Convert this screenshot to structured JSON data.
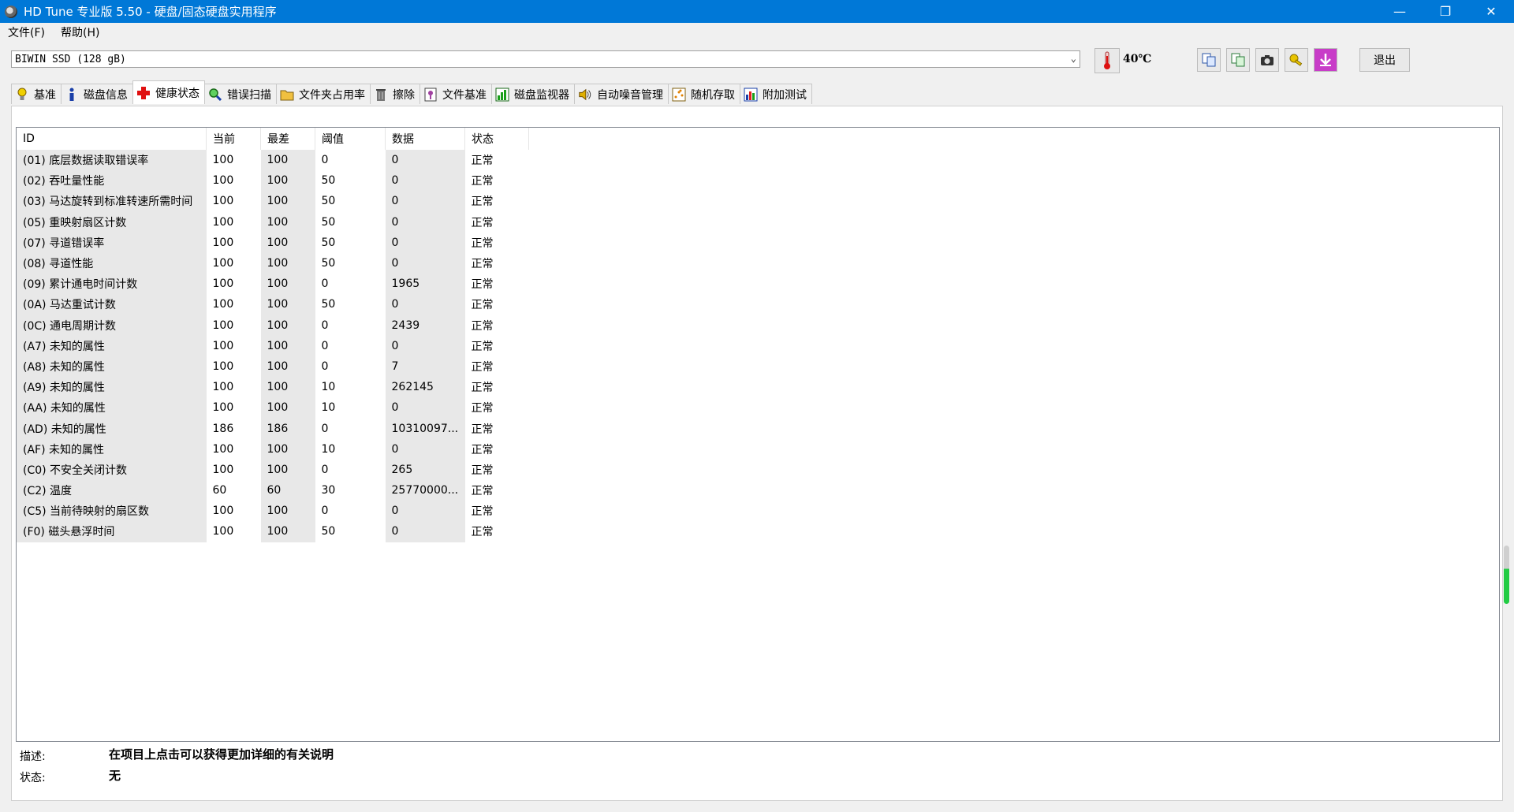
{
  "window": {
    "title": "HD Tune 专业版 5.50 - 硬盘/固态硬盘实用程序"
  },
  "menu": [
    {
      "label": "文件(F)"
    },
    {
      "label": "帮助(H)"
    }
  ],
  "toolbar": {
    "drive": "BIWIN SSD (128 gB)",
    "temperature": "40℃",
    "exit_label": "退出"
  },
  "tabs": [
    {
      "label": "基准",
      "icon": "bulb-icon"
    },
    {
      "label": "磁盘信息",
      "icon": "info-icon"
    },
    {
      "label": "健康状态",
      "icon": "health-cross-icon",
      "active": true
    },
    {
      "label": "错误扫描",
      "icon": "magnifier-icon"
    },
    {
      "label": "文件夹占用率",
      "icon": "folder-icon"
    },
    {
      "label": "擦除",
      "icon": "trash-icon"
    },
    {
      "label": "文件基准",
      "icon": "file-benchmark-icon"
    },
    {
      "label": "磁盘监视器",
      "icon": "chart-monitor-icon"
    },
    {
      "label": "自动噪音管理",
      "icon": "speaker-icon"
    },
    {
      "label": "随机存取",
      "icon": "random-access-icon"
    },
    {
      "label": "附加测试",
      "icon": "extra-tests-icon"
    }
  ],
  "table": {
    "headers": [
      "ID",
      "当前",
      "最差",
      "阈值",
      "数据",
      "状态"
    ],
    "rows": [
      [
        "(01) 底层数据读取错误率",
        "100",
        "100",
        "0",
        "0",
        "正常"
      ],
      [
        "(02) 吞吐量性能",
        "100",
        "100",
        "50",
        "0",
        "正常"
      ],
      [
        "(03) 马达旋转到标准转速所需时间",
        "100",
        "100",
        "50",
        "0",
        "正常"
      ],
      [
        "(05) 重映射扇区计数",
        "100",
        "100",
        "50",
        "0",
        "正常"
      ],
      [
        "(07) 寻道错误率",
        "100",
        "100",
        "50",
        "0",
        "正常"
      ],
      [
        "(08) 寻道性能",
        "100",
        "100",
        "50",
        "0",
        "正常"
      ],
      [
        "(09) 累计通电时间计数",
        "100",
        "100",
        "0",
        "1965",
        "正常"
      ],
      [
        "(0A) 马达重试计数",
        "100",
        "100",
        "50",
        "0",
        "正常"
      ],
      [
        "(0C) 通电周期计数",
        "100",
        "100",
        "0",
        "2439",
        "正常"
      ],
      [
        "(A7) 未知的属性",
        "100",
        "100",
        "0",
        "0",
        "正常"
      ],
      [
        "(A8) 未知的属性",
        "100",
        "100",
        "0",
        "7",
        "正常"
      ],
      [
        "(A9) 未知的属性",
        "100",
        "100",
        "10",
        "262145",
        "正常"
      ],
      [
        "(AA) 未知的属性",
        "100",
        "100",
        "10",
        "0",
        "正常"
      ],
      [
        "(AD) 未知的属性",
        "186",
        "186",
        "0",
        "10310097...",
        "正常"
      ],
      [
        "(AF) 未知的属性",
        "100",
        "100",
        "10",
        "0",
        "正常"
      ],
      [
        "(C0) 不安全关闭计数",
        "100",
        "100",
        "0",
        "265",
        "正常"
      ],
      [
        "(C2) 温度",
        "60",
        "60",
        "30",
        "25770000...",
        "正常"
      ],
      [
        "(C5) 当前待映射的扇区数",
        "100",
        "100",
        "0",
        "0",
        "正常"
      ],
      [
        "(F0) 磁头悬浮时间",
        "100",
        "100",
        "50",
        "0",
        "正常"
      ]
    ]
  },
  "footer": {
    "desc_label": "描述:",
    "desc_value": "在项目上点击可以获得更加详细的有关说明",
    "status_label": "状态:",
    "status_value": "无"
  }
}
